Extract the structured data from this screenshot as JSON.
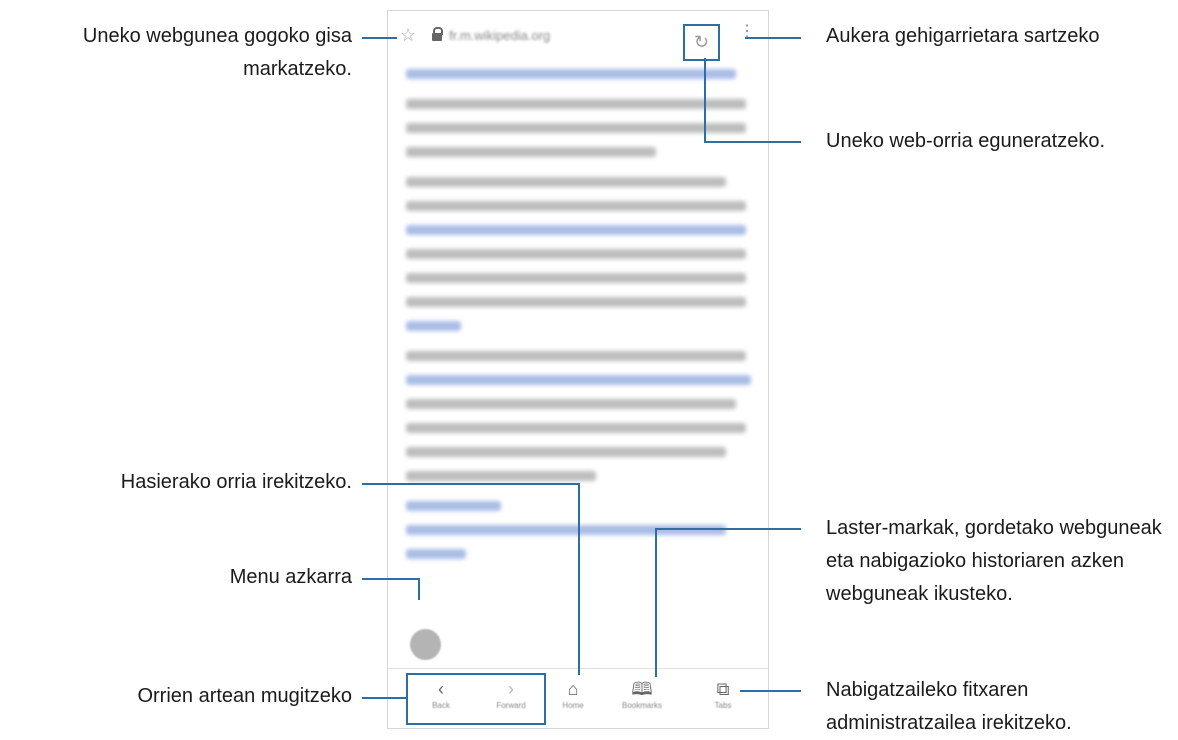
{
  "browser": {
    "url": "fr.m.wikipedia.org",
    "toolbar": {
      "back_label": "Back",
      "forward_label": "Forward",
      "home_label": "Home",
      "bookmarks_label": "Bookmarks",
      "tabs_label": "Tabs"
    }
  },
  "callouts": {
    "bookmark_star": "Uneko webgunea gogoko gisa markatzeko.",
    "more_options": "Aukera gehigarrietara sartzeko",
    "refresh": "Uneko web-orria eguneratzeko.",
    "home": "Hasierako orria irekitzeko.",
    "quick_menu": "Menu azkarra",
    "back_forward": "Orrien artean mugitzeko",
    "bookmarks": "Laster-markak, gordetako webguneak eta nabigazioko historiaren azken webguneak ikusteko.",
    "tabs": "Nabigatzaileko fitxaren administratzailea irekitzeko."
  },
  "icons": {
    "star": "☆",
    "refresh": "↻",
    "more": "⋮",
    "back": "‹",
    "forward": "›",
    "home": "⌂",
    "bookmarks": "🕮",
    "tabs": "⧉"
  },
  "colors": {
    "accent": "#2c6fa7"
  }
}
